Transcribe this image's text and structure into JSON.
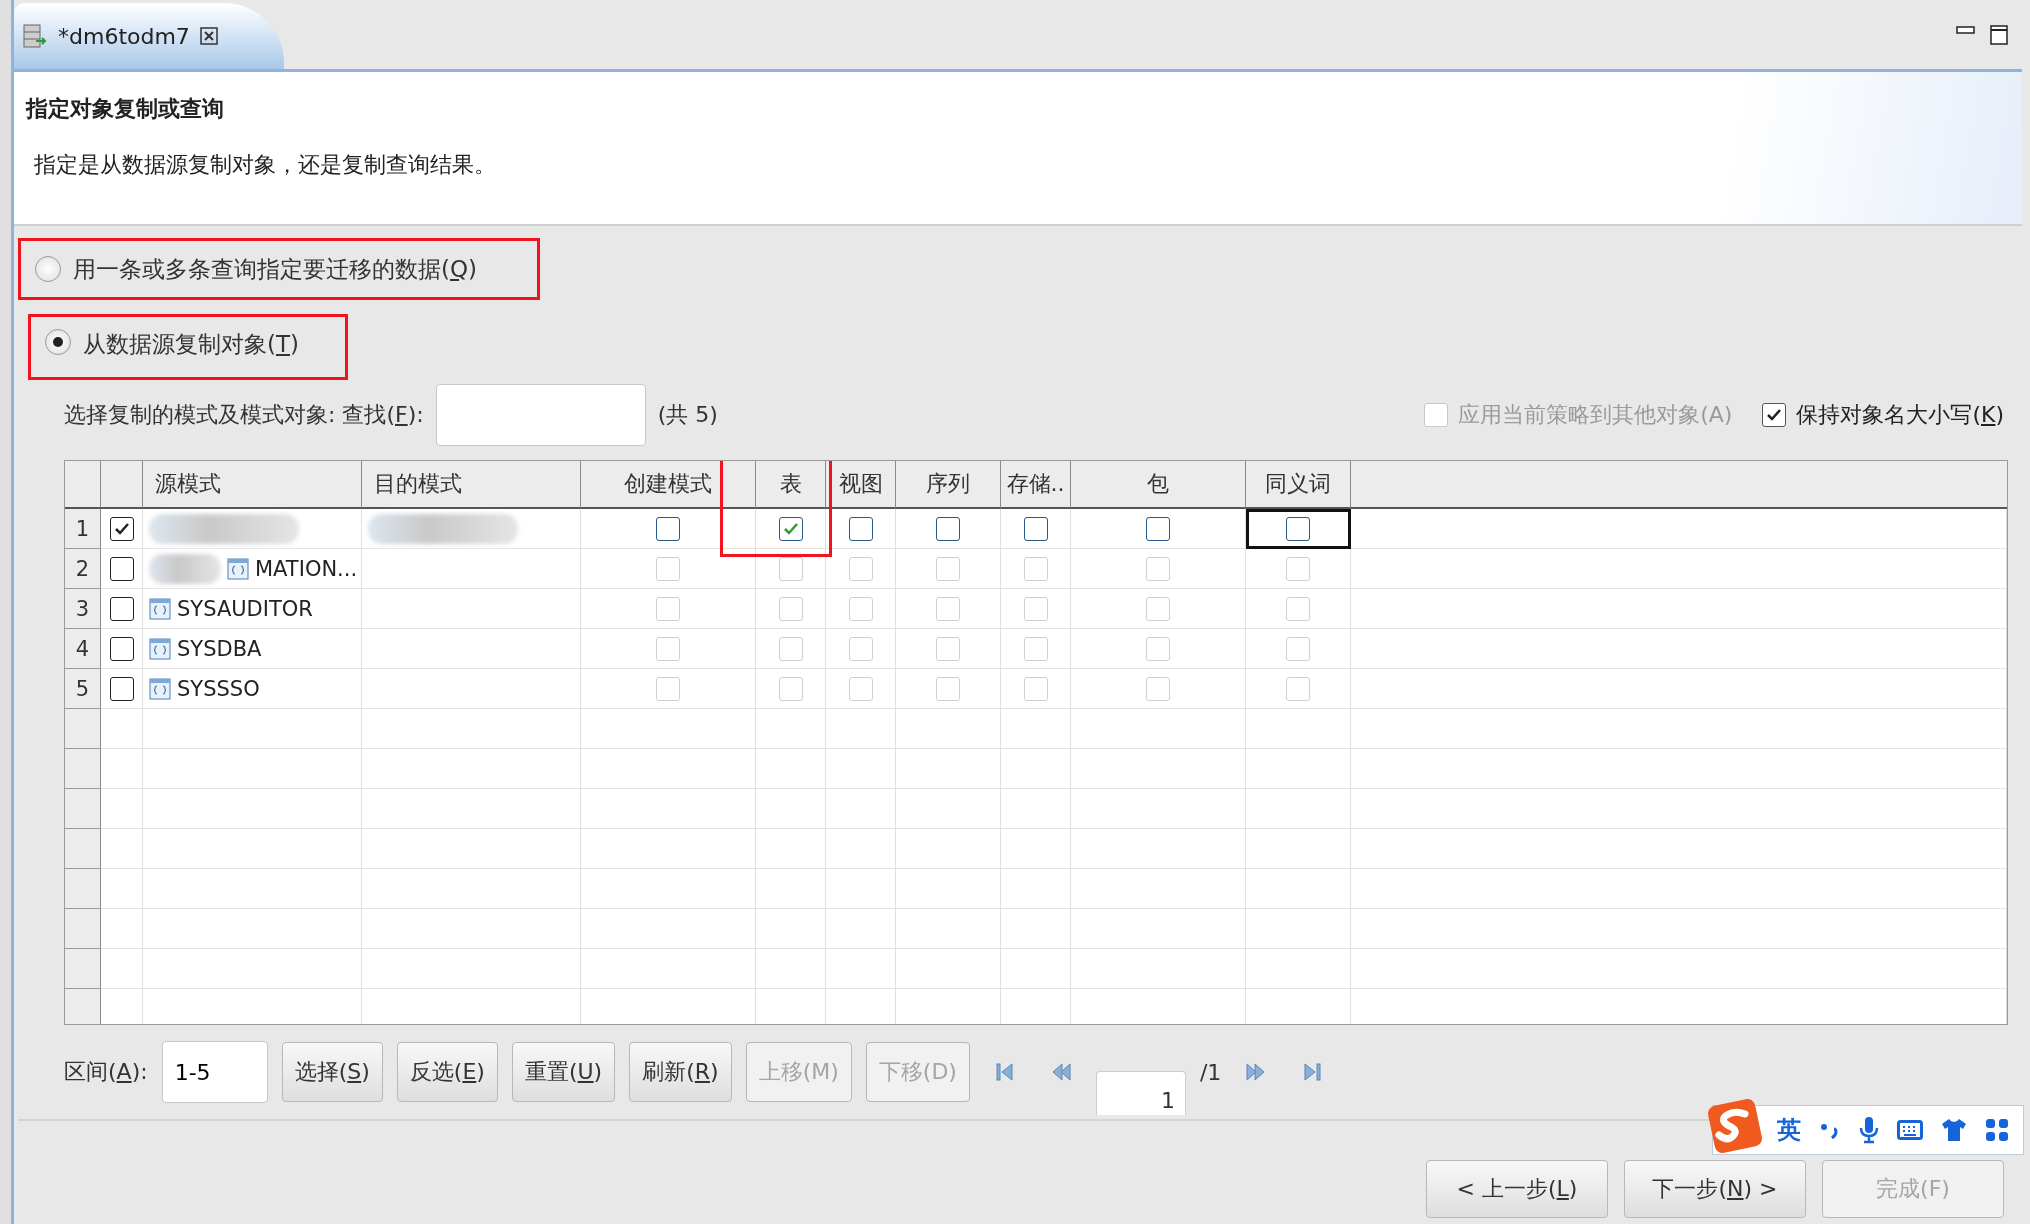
{
  "tab": {
    "title": "*dm6todm7"
  },
  "header": {
    "title": "指定对象复制或查询",
    "description": "指定是从数据源复制对象，还是复制查询结果。"
  },
  "options": [
    {
      "label": "用一条或多条查询指定要迁移的数据(Q)",
      "mnemonic": true,
      "selected": false,
      "highlighted": true
    },
    {
      "label": "从数据源复制对象(T)",
      "mnemonic": true,
      "selected": true,
      "highlighted": true
    }
  ],
  "search": {
    "label": "选择复制的模式及模式对象: 查找(F):",
    "mnemonic": true,
    "count": "(共 5)"
  },
  "toggles": [
    {
      "label": "应用当前策略到其他对象(A)",
      "mnemonic": false,
      "checked": false,
      "disabled": true
    },
    {
      "label": "保持对象名大小写(K)",
      "mnemonic": true,
      "checked": true,
      "disabled": false
    }
  ],
  "table": {
    "columns": [
      {
        "label": "源模式",
        "highlighted": false
      },
      {
        "label": "目的模式",
        "highlighted": false
      },
      {
        "label": "创建模式",
        "highlighted": false
      },
      {
        "label": "表",
        "highlighted": true
      },
      {
        "label": "视图",
        "highlighted": false
      },
      {
        "label": "序列",
        "highlighted": false
      },
      {
        "label": "存储..",
        "highlighted": false
      },
      {
        "label": "包",
        "highlighted": false
      },
      {
        "label": "同义词",
        "highlighted": false
      }
    ],
    "rows": [
      {
        "num": "1",
        "checked": true,
        "source_redacted": true,
        "target_redacted": true,
        "cells": [
          {
            "checked": false,
            "enabled": true,
            "focused": false
          },
          {
            "checked": true,
            "enabled": true,
            "focused": false
          },
          {
            "checked": false,
            "enabled": true,
            "focused": false
          },
          {
            "checked": false,
            "enabled": true,
            "focused": false
          },
          {
            "checked": false,
            "enabled": true,
            "focused": false
          },
          {
            "checked": false,
            "enabled": true,
            "focused": false
          },
          {
            "checked": false,
            "enabled": true,
            "focused": true
          }
        ]
      },
      {
        "num": "2",
        "checked": false,
        "source": "MATION...",
        "source_redacted": true,
        "target_redacted": false,
        "cells": [
          {
            "checked": false,
            "enabled": false,
            "focused": false
          },
          {
            "checked": false,
            "enabled": false,
            "focused": false
          },
          {
            "checked": false,
            "enabled": false,
            "focused": false
          },
          {
            "checked": false,
            "enabled": false,
            "focused": false
          },
          {
            "checked": false,
            "enabled": false,
            "focused": false
          },
          {
            "checked": false,
            "enabled": false,
            "focused": false
          },
          {
            "checked": false,
            "enabled": false,
            "focused": false
          }
        ]
      },
      {
        "num": "3",
        "checked": false,
        "source": "SYSAUDITOR",
        "source_redacted": false,
        "target_redacted": false,
        "cells": [
          {
            "checked": false,
            "enabled": false,
            "focused": false
          },
          {
            "checked": false,
            "enabled": false,
            "focused": false
          },
          {
            "checked": false,
            "enabled": false,
            "focused": false
          },
          {
            "checked": false,
            "enabled": false,
            "focused": false
          },
          {
            "checked": false,
            "enabled": false,
            "focused": false
          },
          {
            "checked": false,
            "enabled": false,
            "focused": false
          },
          {
            "checked": false,
            "enabled": false,
            "focused": false
          }
        ]
      },
      {
        "num": "4",
        "checked": false,
        "source": "SYSDBA",
        "source_redacted": false,
        "target_redacted": false,
        "cells": [
          {
            "checked": false,
            "enabled": false,
            "focused": false
          },
          {
            "checked": false,
            "enabled": false,
            "focused": false
          },
          {
            "checked": false,
            "enabled": false,
            "focused": false
          },
          {
            "checked": false,
            "enabled": false,
            "focused": false
          },
          {
            "checked": false,
            "enabled": false,
            "focused": false
          },
          {
            "checked": false,
            "enabled": false,
            "focused": false
          },
          {
            "checked": false,
            "enabled": false,
            "focused": false
          }
        ]
      },
      {
        "num": "5",
        "checked": false,
        "source": "SYSSSO",
        "source_redacted": false,
        "target_redacted": false,
        "cells": [
          {
            "checked": false,
            "enabled": false,
            "focused": false
          },
          {
            "checked": false,
            "enabled": false,
            "focused": false
          },
          {
            "checked": false,
            "enabled": false,
            "focused": false
          },
          {
            "checked": false,
            "enabled": false,
            "focused": false
          },
          {
            "checked": false,
            "enabled": false,
            "focused": false
          },
          {
            "checked": false,
            "enabled": false,
            "focused": false
          },
          {
            "checked": false,
            "enabled": false,
            "focused": false
          }
        ]
      }
    ]
  },
  "range": {
    "label": "区间(A):",
    "mnemonic": true,
    "value": "1-5"
  },
  "actions": [
    {
      "label": "选择(S)",
      "mnemonic": true,
      "disabled": false
    },
    {
      "label": "反选(E)",
      "mnemonic": true,
      "disabled": false
    },
    {
      "label": "重置(U)",
      "mnemonic": true,
      "disabled": false
    },
    {
      "label": "刷新(R)",
      "mnemonic": true,
      "disabled": false
    },
    {
      "label": "上移(M)",
      "mnemonic": false,
      "disabled": true
    },
    {
      "label": "下移(D)",
      "mnemonic": false,
      "disabled": true
    }
  ],
  "pager": {
    "page": "1",
    "total": "/1"
  },
  "wizard_buttons": [
    {
      "label": "< 上一步(L)",
      "mnemonic": true,
      "disabled": false
    },
    {
      "label": "下一步(N) >",
      "mnemonic": true,
      "disabled": false
    },
    {
      "label": "完成(F)",
      "mnemonic": false,
      "disabled": true
    }
  ],
  "ime_bar": {
    "mode": "英"
  }
}
